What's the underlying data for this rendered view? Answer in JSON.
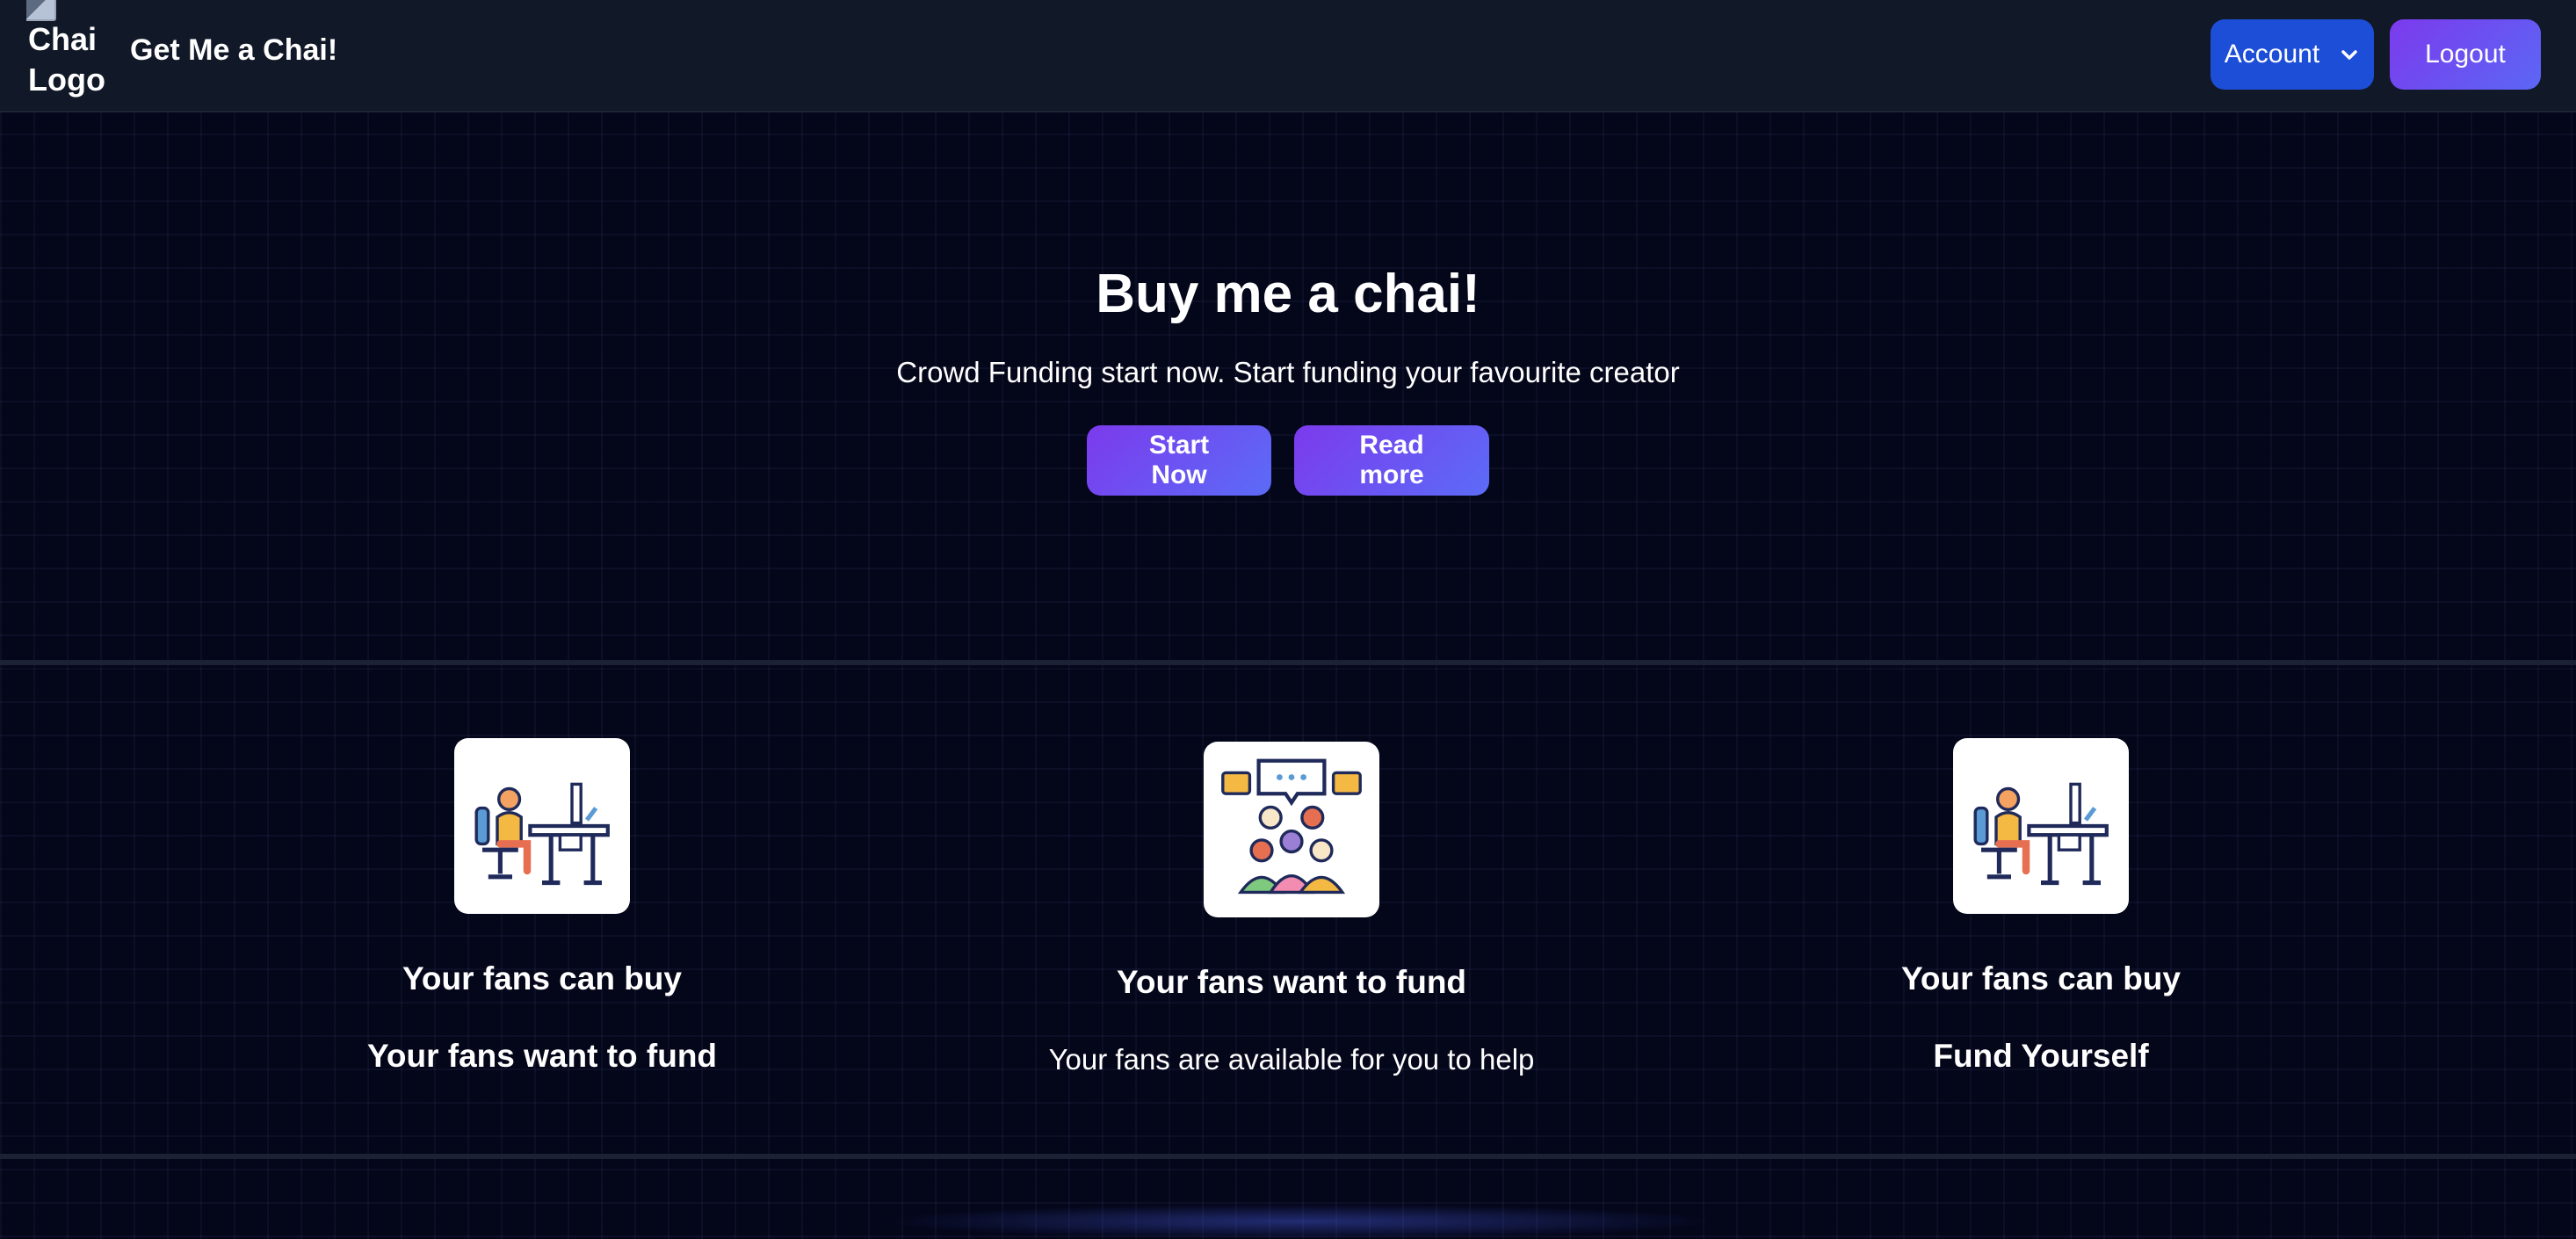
{
  "navbar": {
    "logo_alt": "Chai Logo",
    "brand": "Get Me a Chai!",
    "account_label": "Account",
    "logout_label": "Logout"
  },
  "hero": {
    "title": "Buy me a chai!",
    "subtitle": "Crowd Funding start now. Start funding your favourite creator",
    "start_label": "Start Now",
    "read_more_label": "Read more"
  },
  "features": [
    {
      "icon": "person-at-desk-icon",
      "title": "Your fans can buy",
      "subtitle": "Your fans want to fund"
    },
    {
      "icon": "group-chat-icon",
      "title": "Your fans want to fund",
      "subtitle": "Your fans are available for you to help"
    },
    {
      "icon": "person-at-desk-icon",
      "title": "Your fans can buy",
      "subtitle": "Fund Yourself"
    }
  ],
  "colors": {
    "background": "#04061a",
    "navbar": "#111827",
    "account_button": "#1d4ed8",
    "gradient_start": "#7c3aed",
    "gradient_end": "#5b6cf7"
  }
}
